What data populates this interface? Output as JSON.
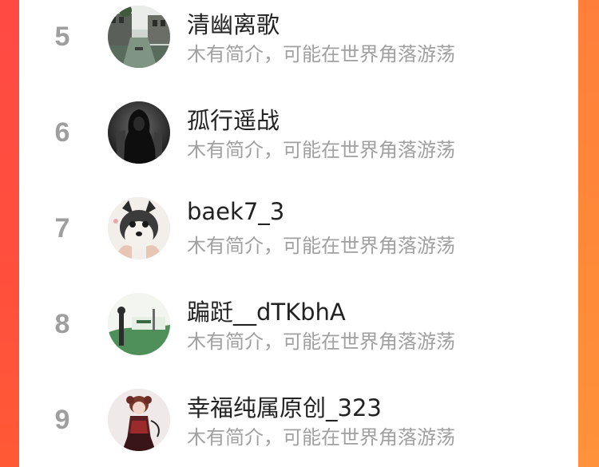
{
  "users": [
    {
      "rank": "5",
      "name": "清幽离歌",
      "bio": "木有简介，可能在世界角落游荡",
      "avatar_icon": "canal-town-photo"
    },
    {
      "rank": "6",
      "name": "孤行遥战",
      "bio": "木有简介，可能在世界角落游荡",
      "avatar_icon": "dark-hooded-figure"
    },
    {
      "rank": "7",
      "name": "baek7_3",
      "bio": "木有简介，可能在世界角落游荡",
      "avatar_icon": "husky-dog"
    },
    {
      "rank": "8",
      "name": "蹁跹__dTKbhA",
      "bio": "木有简介，可能在世界角落游荡",
      "avatar_icon": "anime-scene"
    },
    {
      "rank": "9",
      "name": "幸福纯属原创_323",
      "bio": "木有简介，可能在世界角落游荡",
      "avatar_icon": "gothic-doll"
    }
  ],
  "colors": {
    "accent_left": "#ff4a44",
    "accent_right": "#ff8a38",
    "rank_text": "#9e9e9e",
    "name_text": "#222222",
    "bio_text": "#a0a0a0"
  }
}
